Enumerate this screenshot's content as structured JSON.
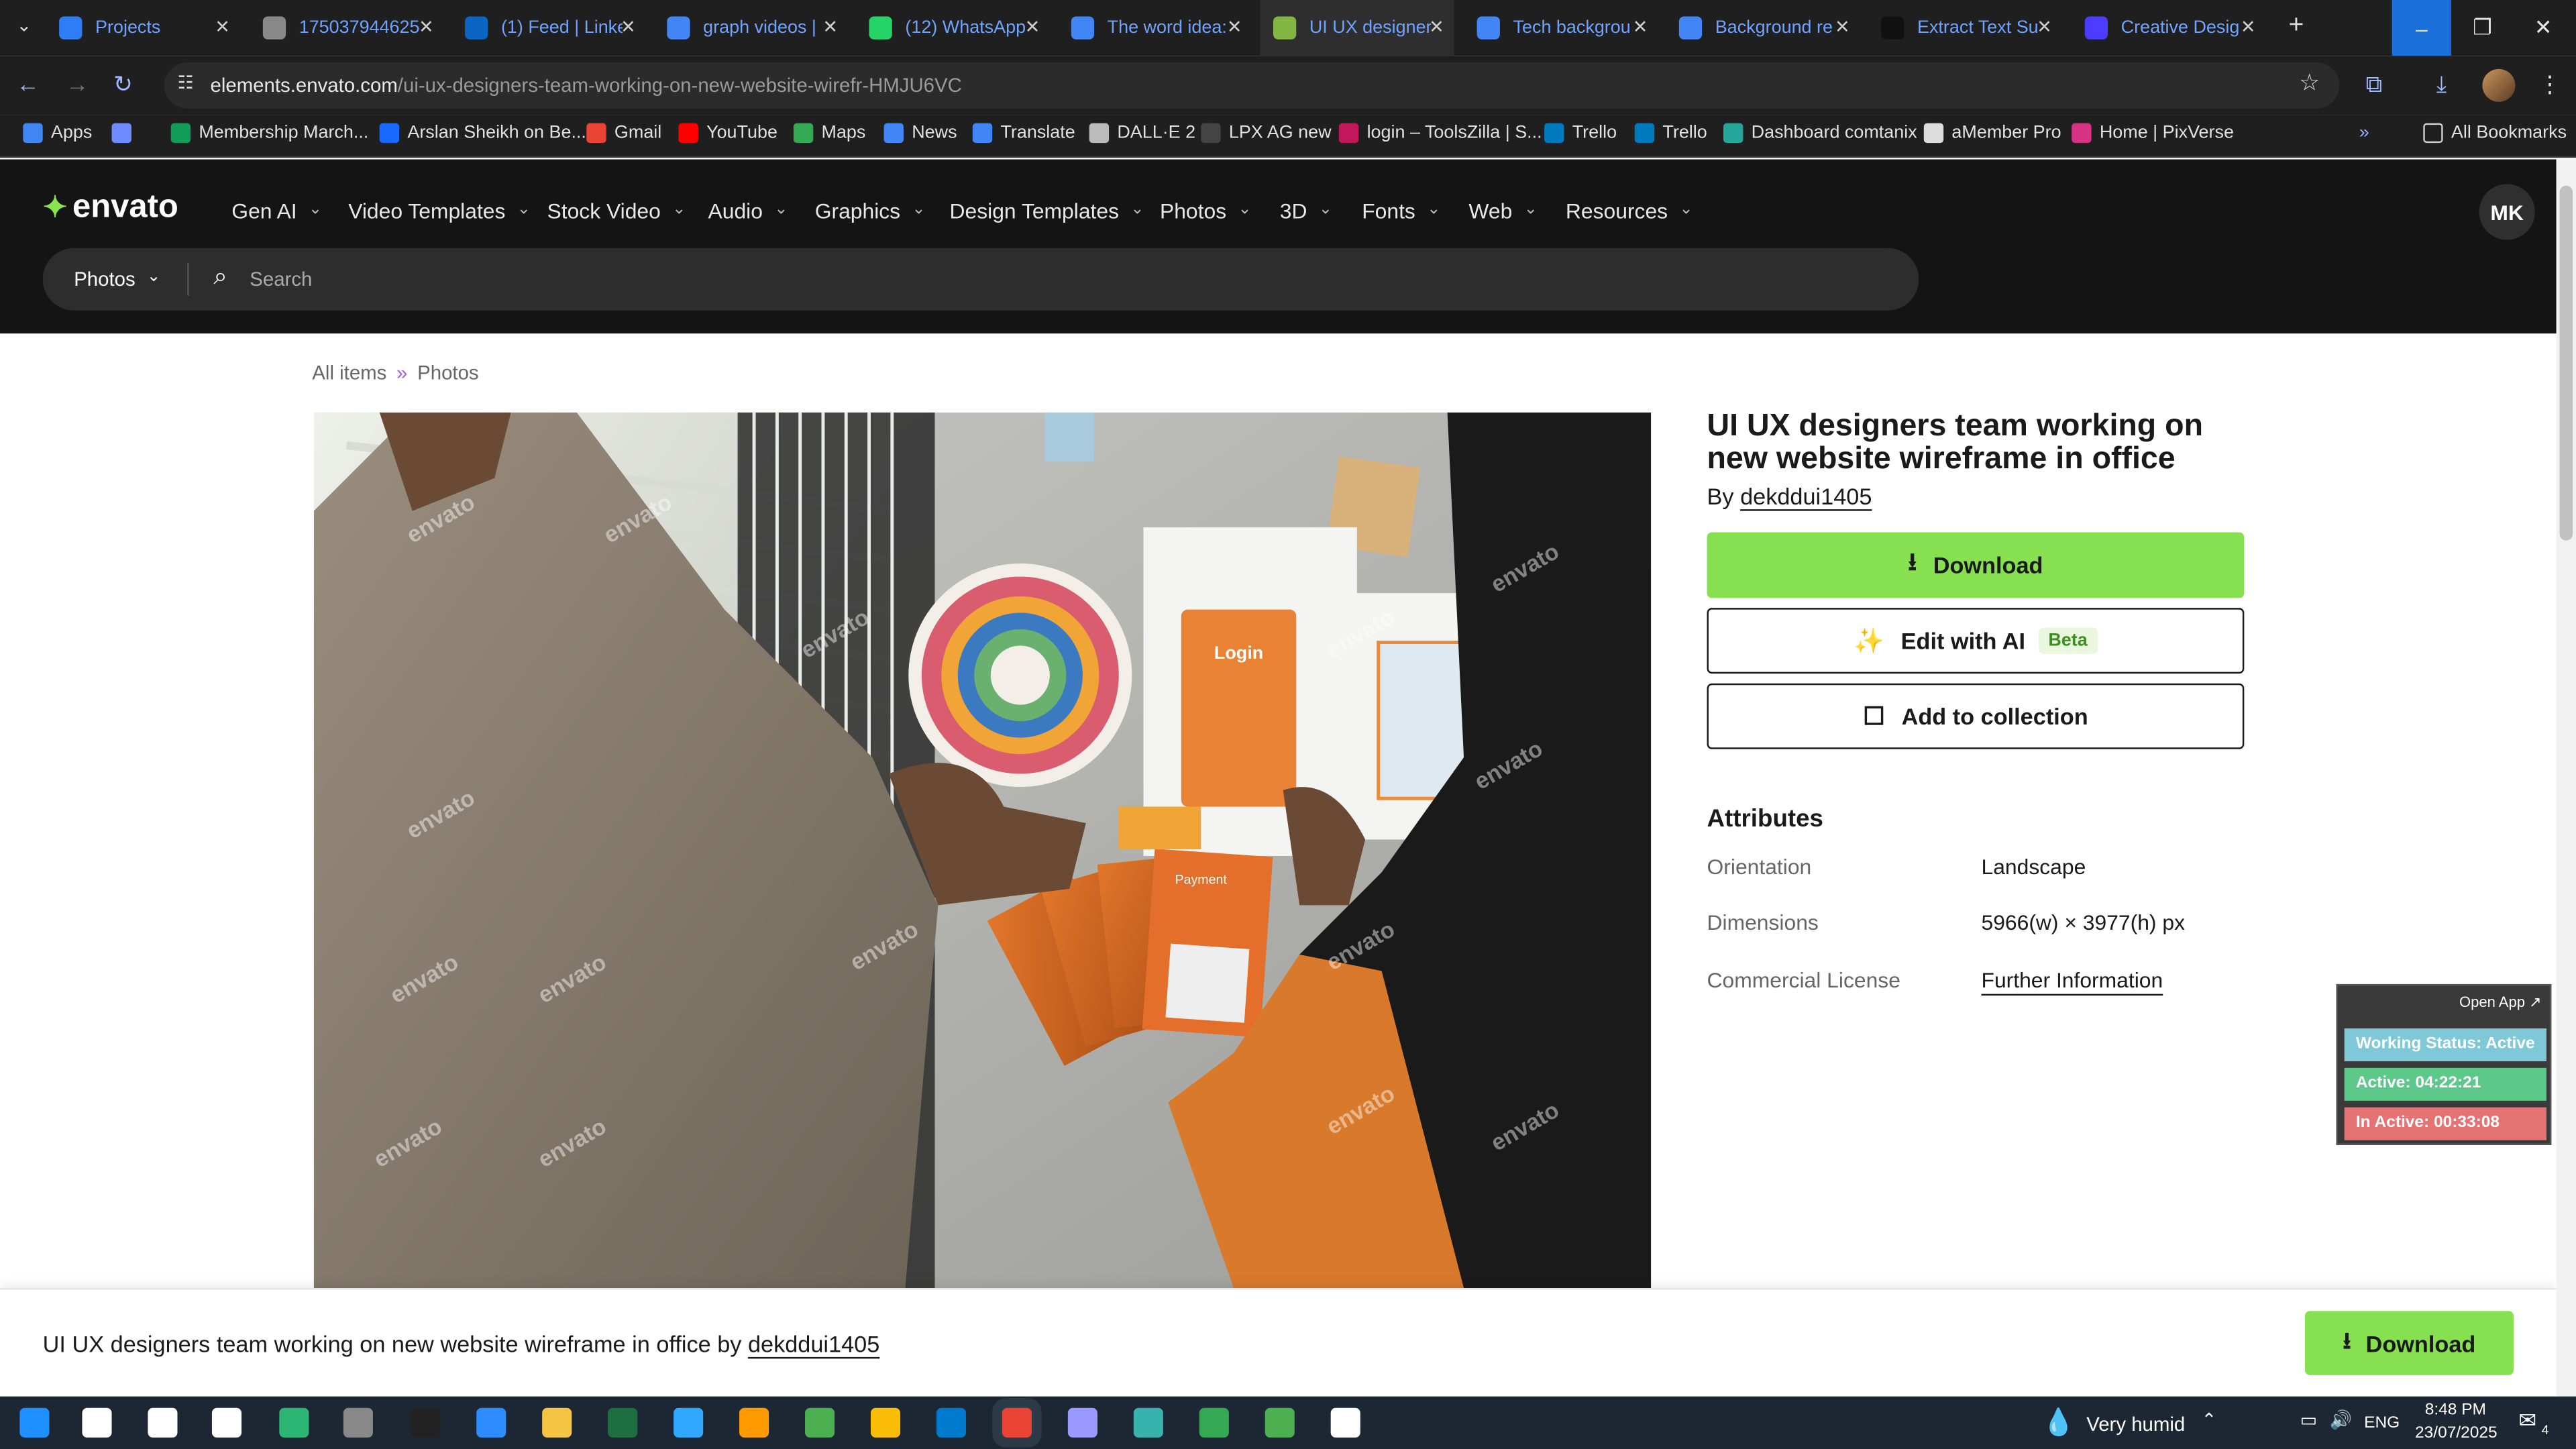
{
  "browser": {
    "tabs": [
      {
        "title": "Projects",
        "icon": "projects-icon",
        "color": "#2e7cf6",
        "active": false
      },
      {
        "title": "175037944625",
        "icon": "globe-icon",
        "color": "#888888",
        "active": false
      },
      {
        "title": "(1) Feed | Linke",
        "icon": "linkedin-icon",
        "color": "#0a66c2",
        "active": false
      },
      {
        "title": "graph videos |",
        "icon": "docs-icon",
        "color": "#4285f4",
        "active": false
      },
      {
        "title": "(12) WhatsApp",
        "icon": "whatsapp-icon",
        "color": "#25d366",
        "active": false
      },
      {
        "title": "The word idea:",
        "icon": "docs-icon",
        "color": "#4285f4",
        "active": false
      },
      {
        "title": "UI UX designer",
        "icon": "envato-icon",
        "color": "#82b541",
        "active": true
      },
      {
        "title": "Tech backgrou",
        "icon": "docs-icon",
        "color": "#4285f4",
        "active": false
      },
      {
        "title": "Background re",
        "icon": "docs-icon",
        "color": "#4285f4",
        "active": false
      },
      {
        "title": "Extract Text Su",
        "icon": "openai-icon",
        "color": "#111111",
        "active": false
      },
      {
        "title": "Creative Desig",
        "icon": "creative-icon",
        "color": "#4b3cff",
        "active": false
      }
    ],
    "url_host": "elements.envato.com",
    "url_path": "/ui-ux-designers-team-working-on-new-website-wirefr-HMJU6VC",
    "bookmarks": [
      {
        "label": "Apps",
        "color": "#4285f4"
      },
      {
        "label": "",
        "color": "#6e8cff"
      },
      {
        "label": "Membership March...",
        "color": "#0f9d58"
      },
      {
        "label": "Arslan Sheikh on Be...",
        "color": "#1769ff"
      },
      {
        "label": "Gmail",
        "color": "#ea4335"
      },
      {
        "label": "YouTube",
        "color": "#ff0000"
      },
      {
        "label": "Maps",
        "color": "#34a853"
      },
      {
        "label": "News",
        "color": "#4285f4"
      },
      {
        "label": "Translate",
        "color": "#4285f4"
      },
      {
        "label": "DALL·E 2",
        "color": "#bbbbbb"
      },
      {
        "label": "LPX AG new",
        "color": "#444444"
      },
      {
        "label": "login – ToolsZilla | S...",
        "color": "#c2185b"
      },
      {
        "label": "Trello",
        "color": "#0079bf"
      },
      {
        "label": "Trello",
        "color": "#0079bf"
      },
      {
        "label": "Dashboard comtanix",
        "color": "#26a69a"
      },
      {
        "label": "aMember Pro",
        "color": "#dddddd"
      },
      {
        "label": "Home | PixVerse",
        "color": "#d63384"
      }
    ],
    "all_bookmarks": "All Bookmarks"
  },
  "site": {
    "logo": "envato",
    "nav": [
      "Gen AI",
      "Video Templates",
      "Stock Video",
      "Audio",
      "Graphics",
      "Design Templates",
      "Photos",
      "3D",
      "Fonts",
      "Web",
      "Resources"
    ],
    "avatar": "MK",
    "search_category": "Photos",
    "search_placeholder": "Search"
  },
  "breadcrumb": {
    "items": [
      "All items",
      "Photos"
    ],
    "separator": "»"
  },
  "item": {
    "title": "UI UX designers team working on new website wireframe in office",
    "by": "By",
    "author": "dekddui1405",
    "download": "Download",
    "edit_ai": "Edit with AI",
    "beta": "Beta",
    "add_collection": "Add to collection"
  },
  "attributes": {
    "title": "Attributes",
    "rows": [
      {
        "key": "Orientation",
        "value": "Landscape"
      },
      {
        "key": "Dimensions",
        "value": "5966(w) × 3977(h) px"
      },
      {
        "key": "Commercial License",
        "value": "Further Information"
      }
    ]
  },
  "widget": {
    "open_app": "Open App ↗",
    "status": "Working Status: Active",
    "active": "Active: 04:22:21",
    "inactive": "In Active: 00:33:08",
    "colors": {
      "status": "#7ec8d8",
      "active": "#5cc98a",
      "inactive": "#e57373"
    }
  },
  "sticky": {
    "text": "UI UX designers team working on new website wireframe in office by",
    "author": "dekddui1405",
    "download": "Download"
  },
  "photo": {
    "watermark": "envato",
    "card_login": "Login",
    "card_payment": "Payment"
  },
  "taskbar": {
    "weather": "Very humid",
    "lang": "ENG",
    "time": "8:48 PM",
    "date": "23/07/2025",
    "notifications": "4"
  },
  "colors": {
    "accent": "#87e04f",
    "header_bg": "#141414",
    "breadcrumb_sep": "#a263d9"
  }
}
